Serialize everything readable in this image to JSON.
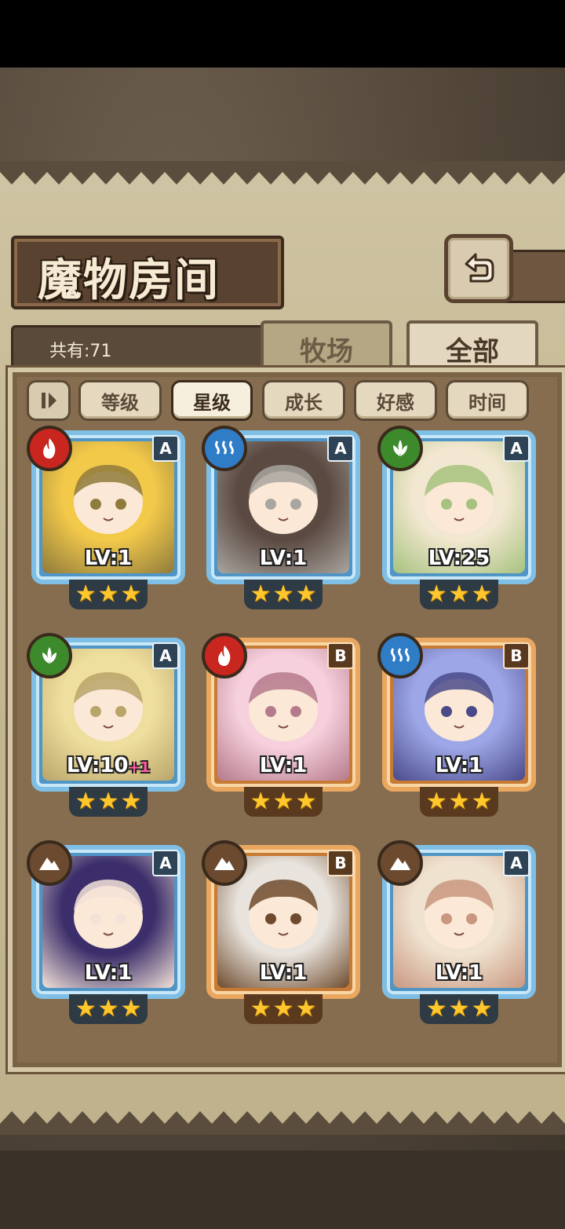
{
  "header": {
    "title": "魔物房间",
    "count_label": "共有:71"
  },
  "tabs": [
    {
      "label": "牧场",
      "active": false
    },
    {
      "label": "全部",
      "active": true
    }
  ],
  "sort_buttons": [
    {
      "label": "等级",
      "active": false
    },
    {
      "label": "星级",
      "active": true
    },
    {
      "label": "成长",
      "active": false
    },
    {
      "label": "好感",
      "active": false
    },
    {
      "label": "时间",
      "active": false
    }
  ],
  "monsters": [
    {
      "level": "LV:1",
      "plus": "",
      "rank": "A",
      "element": "fire",
      "stars": 3,
      "colors": [
        "#f3c94a",
        "#8f7b3c"
      ]
    },
    {
      "level": "LV:1",
      "plus": "",
      "rank": "A",
      "element": "water",
      "stars": 3,
      "colors": [
        "#5b4a42",
        "#a9a59f"
      ]
    },
    {
      "level": "LV:25",
      "plus": "",
      "rank": "A",
      "element": "leaf",
      "stars": 3,
      "colors": [
        "#f2e7d0",
        "#a6c27e"
      ]
    },
    {
      "level": "LV:10",
      "plus": "+1",
      "rank": "A",
      "element": "leaf",
      "stars": 3,
      "colors": [
        "#efdf9e",
        "#b9a56a"
      ]
    },
    {
      "level": "LV:1",
      "plus": "",
      "rank": "B",
      "element": "fire",
      "stars": 3,
      "colors": [
        "#f6d0dc",
        "#b57a8c"
      ]
    },
    {
      "level": "LV:1",
      "plus": "",
      "rank": "B",
      "element": "water",
      "stars": 3,
      "colors": [
        "#9da6e6",
        "#4a4a8a"
      ]
    },
    {
      "level": "LV:1",
      "plus": "",
      "rank": "A",
      "element": "earth",
      "stars": 3,
      "colors": [
        "#3b2e6a",
        "#f3e2d8"
      ]
    },
    {
      "level": "LV:1",
      "plus": "",
      "rank": "B",
      "element": "earth",
      "stars": 3,
      "colors": [
        "#e8e3dc",
        "#6e4b2e"
      ]
    },
    {
      "level": "LV:1",
      "plus": "",
      "rank": "A",
      "element": "earth",
      "stars": 3,
      "colors": [
        "#efe3d0",
        "#c99780"
      ]
    }
  ],
  "element_colors": {
    "fire": "#c8261f",
    "water": "#2f7cc7",
    "leaf": "#3c8a2c",
    "earth": "#6b4a30"
  },
  "star_glyph": "★"
}
